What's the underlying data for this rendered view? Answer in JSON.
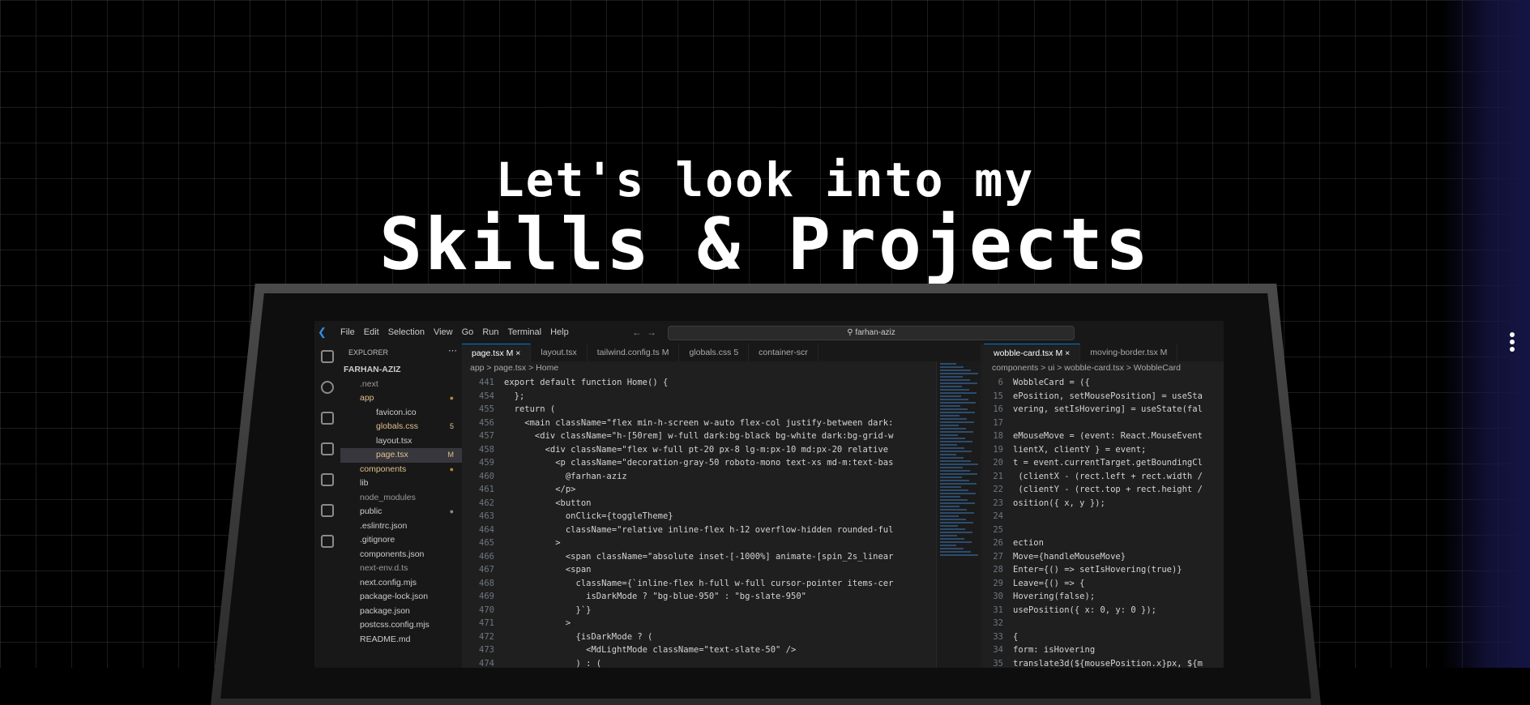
{
  "hero": {
    "line1": "Let's look into my",
    "line2": "Skills & Projects"
  },
  "vscode": {
    "menus": [
      "File",
      "Edit",
      "Selection",
      "View",
      "Go",
      "Run",
      "Terminal",
      "Help"
    ],
    "search": "farhan-aziz",
    "explorer_title": "EXPLORER",
    "tree": [
      {
        "label": "FARHAN-AZIZ",
        "indent": 4,
        "color": "#cccccc",
        "bold": true
      },
      {
        "label": ".next",
        "indent": 24,
        "color": "#9a9a9a"
      },
      {
        "label": "app",
        "indent": 24,
        "color": "#e2c08d",
        "badge": "●",
        "badge_color": "#b0873a"
      },
      {
        "label": "favicon.ico",
        "indent": 44,
        "color": "#cccccc"
      },
      {
        "label": "globals.css",
        "indent": 44,
        "color": "#e2c08d",
        "badge": "5",
        "badge_color": "#e2c08d"
      },
      {
        "label": "layout.tsx",
        "indent": 44,
        "color": "#cccccc"
      },
      {
        "label": "page.tsx",
        "indent": 44,
        "color": "#e2c08d",
        "badge": "M",
        "badge_color": "#e2c08d",
        "selected": true
      },
      {
        "label": "components",
        "indent": 24,
        "color": "#e2c08d",
        "badge": "●",
        "badge_color": "#b0873a"
      },
      {
        "label": "lib",
        "indent": 24,
        "color": "#cccccc"
      },
      {
        "label": "node_modules",
        "indent": 24,
        "color": "#9a9a9a"
      },
      {
        "label": "public",
        "indent": 24,
        "color": "#cccccc",
        "badge": "●",
        "badge_color": "#8a8a8a"
      },
      {
        "label": ".eslintrc.json",
        "indent": 24,
        "color": "#cccccc"
      },
      {
        "label": ".gitignore",
        "indent": 24,
        "color": "#cccccc"
      },
      {
        "label": "components.json",
        "indent": 24,
        "color": "#cccccc"
      },
      {
        "label": "next-env.d.ts",
        "indent": 24,
        "color": "#9a9a9a"
      },
      {
        "label": "next.config.mjs",
        "indent": 24,
        "color": "#cccccc"
      },
      {
        "label": "package-lock.json",
        "indent": 24,
        "color": "#cccccc"
      },
      {
        "label": "package.json",
        "indent": 24,
        "color": "#cccccc"
      },
      {
        "label": "postcss.config.mjs",
        "indent": 24,
        "color": "#cccccc"
      },
      {
        "label": "README.md",
        "indent": 24,
        "color": "#cccccc"
      }
    ],
    "left_tabs": [
      {
        "label": "page.tsx  M  ×",
        "active": true
      },
      {
        "label": "layout.tsx"
      },
      {
        "label": "tailwind.config.ts  M"
      },
      {
        "label": "globals.css  5"
      },
      {
        "label": "container-scr"
      }
    ],
    "left_crumb": "app  >  page.tsx  >  Home",
    "left_code": [
      {
        "n": "441",
        "t": "export default function Home() {"
      },
      {
        "n": "454",
        "t": "  };"
      },
      {
        "n": "455",
        "t": "  return ("
      },
      {
        "n": "456",
        "t": "    <main className=\"flex min-h-screen w-auto flex-col justify-between dark:"
      },
      {
        "n": "457",
        "t": "      <div className=\"h-[50rem] w-full dark:bg-black bg-white dark:bg-grid-w"
      },
      {
        "n": "458",
        "t": "        <div className=\"flex w-full pt-20 px-8 lg-m:px-10 md:px-20 relative"
      },
      {
        "n": "459",
        "t": "          <p className=\"decoration-gray-50 roboto-mono text-xs md-m:text-bas"
      },
      {
        "n": "460",
        "t": "            @farhan-aziz"
      },
      {
        "n": "461",
        "t": "          </p>"
      },
      {
        "n": "462",
        "t": "          <button"
      },
      {
        "n": "463",
        "t": "            onClick={toggleTheme}"
      },
      {
        "n": "464",
        "t": "            className=\"relative inline-flex h-12 overflow-hidden rounded-ful"
      },
      {
        "n": "465",
        "t": "          >"
      },
      {
        "n": "466",
        "t": "            <span className=\"absolute inset-[-1000%] animate-[spin_2s_linear"
      },
      {
        "n": "467",
        "t": "            <span"
      },
      {
        "n": "468",
        "t": "              className={`inline-flex h-full w-full cursor-pointer items-cer"
      },
      {
        "n": "469",
        "t": "                isDarkMode ? \"bg-blue-950\" : \"bg-slate-950\""
      },
      {
        "n": "470",
        "t": "              }`}"
      },
      {
        "n": "471",
        "t": "            >"
      },
      {
        "n": "472",
        "t": "              {isDarkMode ? ("
      },
      {
        "n": "473",
        "t": "                <MdLightMode className=\"text-slate-50\" />"
      },
      {
        "n": "474",
        "t": "              ) : ("
      }
    ],
    "right_tabs": [
      {
        "label": "wobble-card.tsx  M  ×",
        "active": true
      },
      {
        "label": "moving-border.tsx  M"
      }
    ],
    "right_crumb": "components  >  ui  >  wobble-card.tsx  >  WobbleCard",
    "right_code": [
      {
        "n": "6",
        "t": "WobbleCard = ({"
      },
      {
        "n": "15",
        "t": "ePosition, setMousePosition] = useSta"
      },
      {
        "n": "16",
        "t": "vering, setIsHovering] = useState(fal"
      },
      {
        "n": "17",
        "t": ""
      },
      {
        "n": "18",
        "t": "eMouseMove = (event: React.MouseEvent"
      },
      {
        "n": "19",
        "t": "lientX, clientY } = event;"
      },
      {
        "n": "20",
        "t": "t = event.currentTarget.getBoundingCl"
      },
      {
        "n": "21",
        "t": " (clientX - (rect.left + rect.width /"
      },
      {
        "n": "22",
        "t": " (clientY - (rect.top + rect.height /"
      },
      {
        "n": "23",
        "t": "osition({ x, y });"
      },
      {
        "n": "24",
        "t": ""
      },
      {
        "n": "25",
        "t": ""
      },
      {
        "n": "26",
        "t": "ection"
      },
      {
        "n": "27",
        "t": "Move={handleMouseMove}"
      },
      {
        "n": "28",
        "t": "Enter={() => setIsHovering(true)}"
      },
      {
        "n": "29",
        "t": "Leave={() => {"
      },
      {
        "n": "30",
        "t": "Hovering(false);"
      },
      {
        "n": "31",
        "t": "usePosition({ x: 0, y: 0 });"
      },
      {
        "n": "32",
        "t": ""
      },
      {
        "n": "33",
        "t": "{"
      },
      {
        "n": "34",
        "t": "form: isHovering"
      },
      {
        "n": "35",
        "t": "translate3d(${mousePosition.x}px, ${m"
      }
    ]
  }
}
